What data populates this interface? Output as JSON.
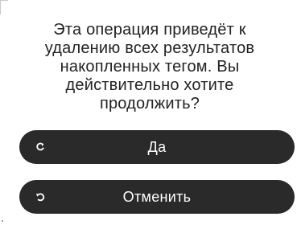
{
  "dialog": {
    "message": "Эта операция приведёт к удалению всех результатов накопленных тегом. Вы действительно хотите продолжить?",
    "confirm": {
      "label": "Да",
      "icon": "refresh-icon"
    },
    "cancel": {
      "label": "Отменить",
      "icon": "undo-icon"
    }
  },
  "colors": {
    "button_bg": "#2a2a2a",
    "button_text": "#ffffff",
    "message_text": "#222222"
  }
}
